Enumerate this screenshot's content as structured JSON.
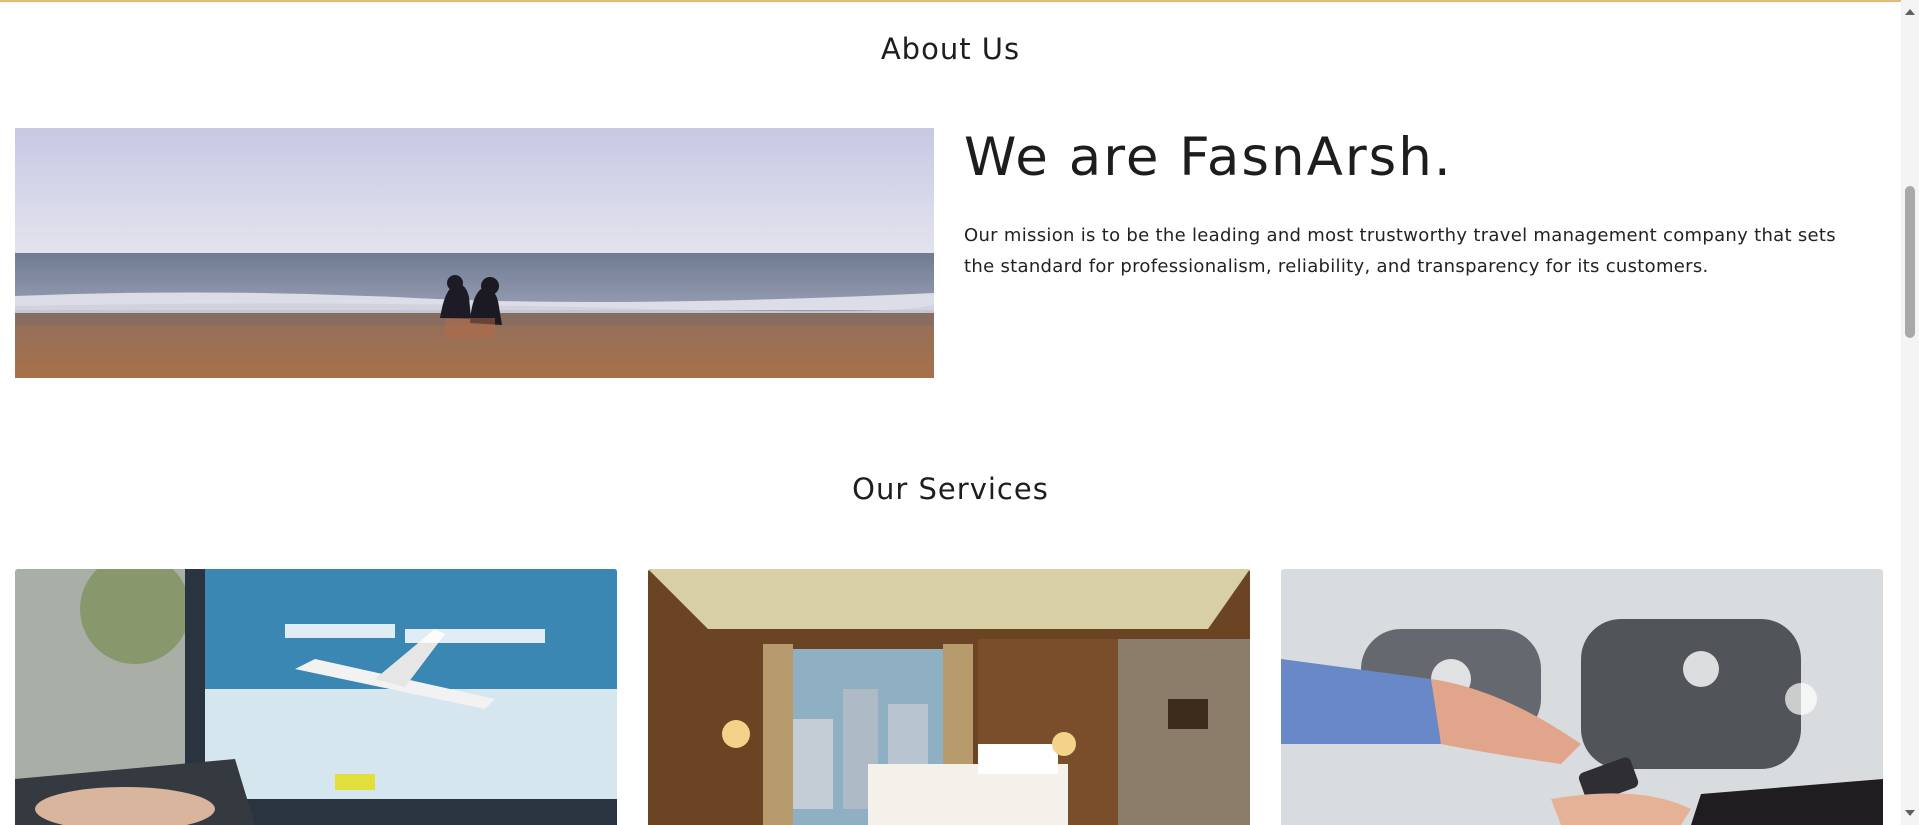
{
  "about": {
    "title": "About Us",
    "heading": "We are FasnArsh.",
    "mission": "Our mission is to be the leading and most trustworthy travel management company that sets the standard for professionalism, reliability, and transparency for its customers."
  },
  "services": {
    "title": "Our Services",
    "cards": [
      {
        "image": "flight-search-laptop-photo"
      },
      {
        "image": "hotel-room-photo"
      },
      {
        "image": "car-key-handover-photo"
      }
    ]
  },
  "colors": {
    "top_border": "#e8b878",
    "text": "#222222",
    "scroll_thumb": "#a8a8a8"
  }
}
